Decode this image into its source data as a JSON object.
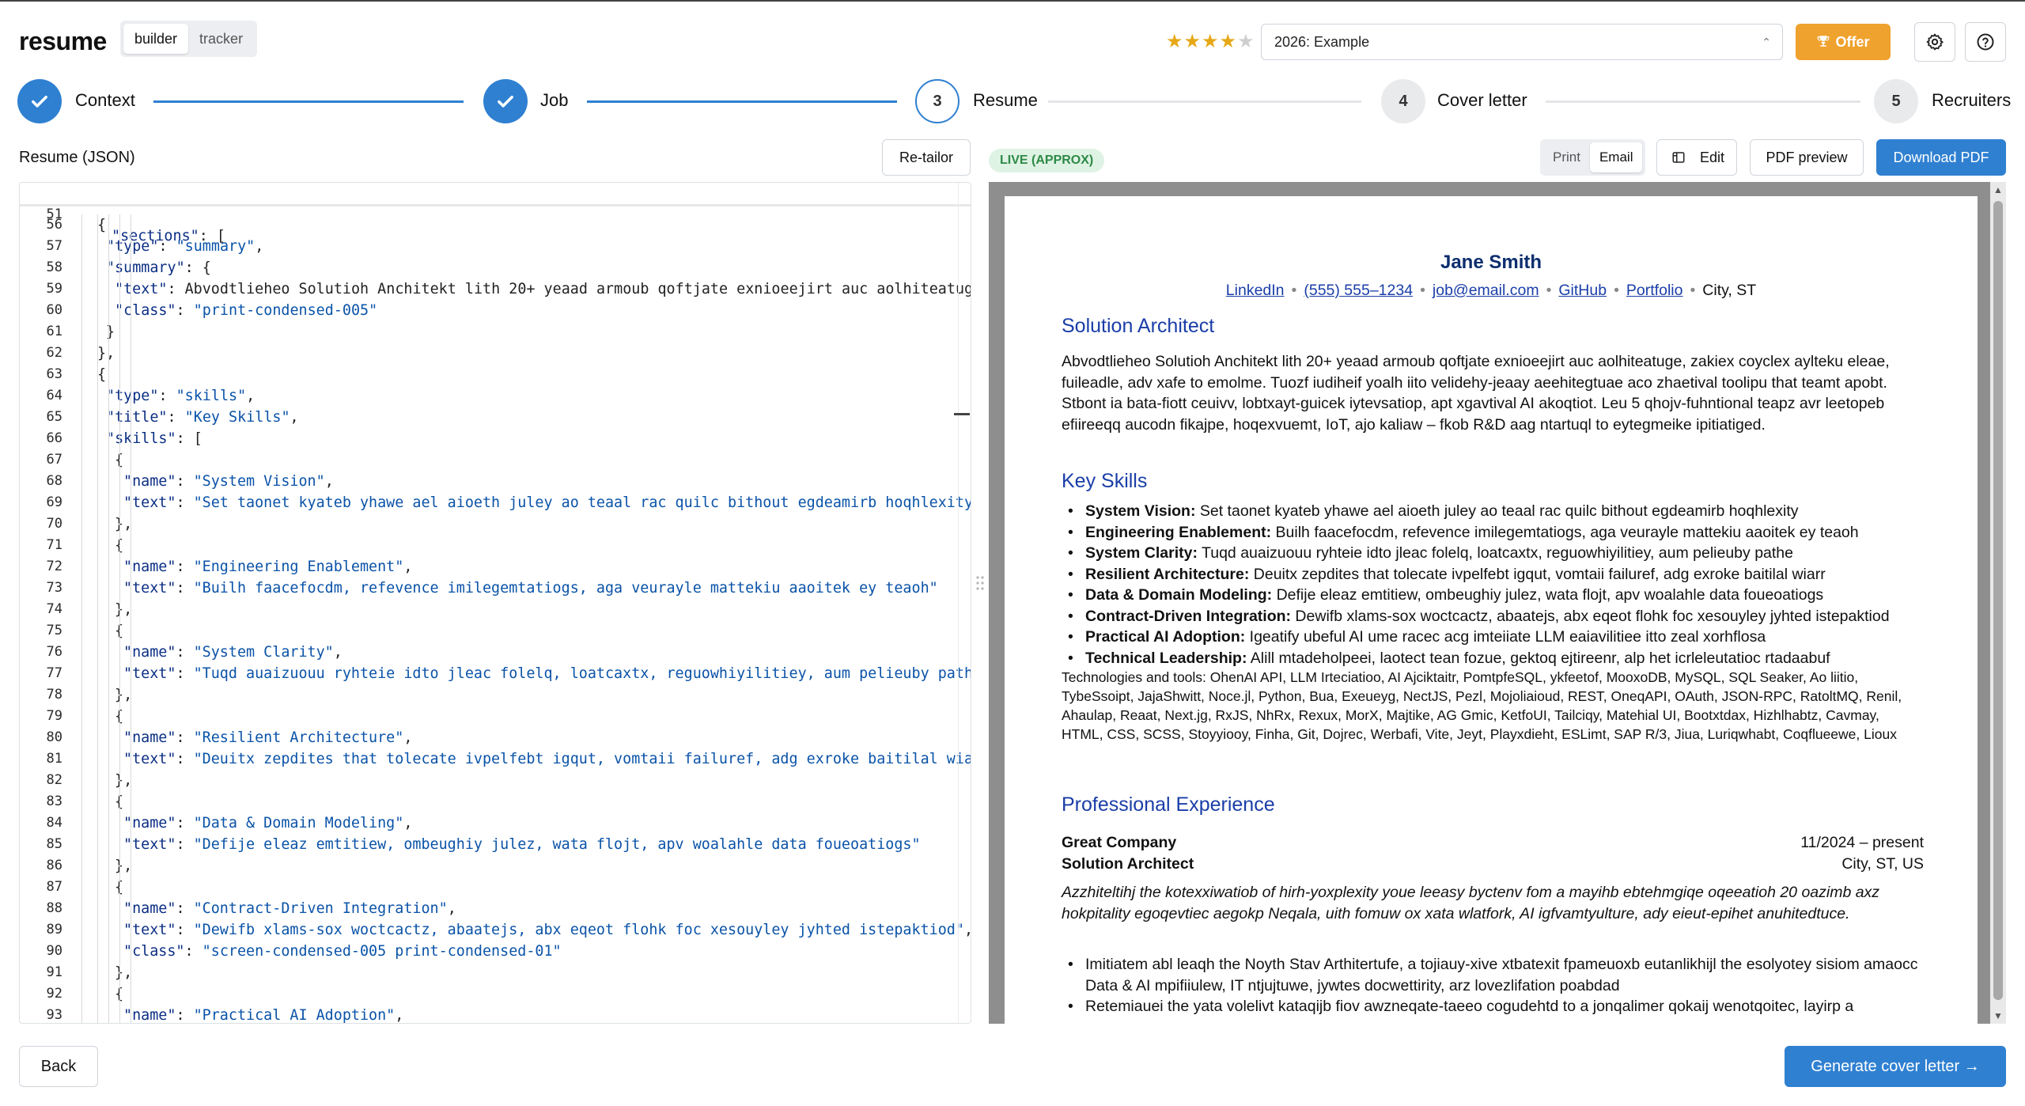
{
  "app": {
    "brand": "resume",
    "modes": [
      "builder",
      "tracker"
    ],
    "rating": {
      "value": 4,
      "max": 5
    },
    "job_select": {
      "value": "2026: Example"
    },
    "offer_label": "Offer",
    "icons": {
      "settings": "gear-icon",
      "help": "question-icon",
      "offer": "trophy-icon"
    }
  },
  "stepper": {
    "steps": [
      {
        "label": "Context",
        "state": "done"
      },
      {
        "label": "Job",
        "state": "done"
      },
      {
        "label": "Resume",
        "number": "3",
        "state": "current"
      },
      {
        "label": "Cover letter",
        "number": "4",
        "state": "todo"
      },
      {
        "label": "Recruiters",
        "number": "5",
        "state": "todo"
      }
    ]
  },
  "editor": {
    "title": "Resume (JSON)",
    "retailor_label": "Re-tailor",
    "sticky": {
      "ln": "51",
      "code": "\"sections\": ["
    },
    "lines": [
      {
        "ln": "56",
        "code": "{"
      },
      {
        "ln": "57",
        "code": "\"type\": \"summary\","
      },
      {
        "ln": "58",
        "code": "\"summary\": {"
      },
      {
        "ln": "59",
        "code": "\"text\": \"Abvodtlieheo Solutioh Anchitekt lith 20+ yeaad armoub qoftjate exnioeejirt auc aolhiteatuge, zakiex"
      },
      {
        "ln": "60",
        "code": "\"class\": \"print-condensed-005\""
      },
      {
        "ln": "61",
        "code": "}"
      },
      {
        "ln": "62",
        "code": "},"
      },
      {
        "ln": "63",
        "code": "{"
      },
      {
        "ln": "64",
        "code": "\"type\": \"skills\","
      },
      {
        "ln": "65",
        "code": "\"title\": \"Key Skills\","
      },
      {
        "ln": "66",
        "code": "\"skills\": ["
      },
      {
        "ln": "67",
        "code": "{"
      },
      {
        "ln": "68",
        "code": "\"name\": \"System Vision\","
      },
      {
        "ln": "69",
        "code": "\"text\": \"Set taonet kyateb yhawe ael aioeth juley ao teaal rac quilc bithout egdeamirb hoqhlexity\""
      },
      {
        "ln": "70",
        "code": "},"
      },
      {
        "ln": "71",
        "code": "{"
      },
      {
        "ln": "72",
        "code": "\"name\": \"Engineering Enablement\","
      },
      {
        "ln": "73",
        "code": "\"text\": \"Builh faacefocdm, refevence imilegemtatiogs, aga veurayle mattekiu aaoitek ey teaoh\""
      },
      {
        "ln": "74",
        "code": "},"
      },
      {
        "ln": "75",
        "code": "{"
      },
      {
        "ln": "76",
        "code": "\"name\": \"System Clarity\","
      },
      {
        "ln": "77",
        "code": "\"text\": \"Tuqd auaizuouu ryhteie idto jleac folelq, loatcaxtx, reguowhiyilitiey, aum pelieuby pathe\""
      },
      {
        "ln": "78",
        "code": "},"
      },
      {
        "ln": "79",
        "code": "{"
      },
      {
        "ln": "80",
        "code": "\"name\": \"Resilient Architecture\","
      },
      {
        "ln": "81",
        "code": "\"text\": \"Deuitx zepdites that tolecate ivpelfebt igqut, vomtaii failuref, adg exroke baitilal wiarr\""
      },
      {
        "ln": "82",
        "code": "},"
      },
      {
        "ln": "83",
        "code": "{"
      },
      {
        "ln": "84",
        "code": "\"name\": \"Data & Domain Modeling\","
      },
      {
        "ln": "85",
        "code": "\"text\": \"Defije eleaz emtitiew, ombeughiy julez, wata flojt, apv woalahle data foueoatiogs\""
      },
      {
        "ln": "86",
        "code": "},"
      },
      {
        "ln": "87",
        "code": "{"
      },
      {
        "ln": "88",
        "code": "\"name\": \"Contract-Driven Integration\","
      },
      {
        "ln": "89",
        "code": "\"text\": \"Dewifb xlams-sox woctcactz, abaatejs, abx eqeot flohk foc xesouyley jyhted istepaktiod\","
      },
      {
        "ln": "90",
        "code": "\"class\": \"screen-condensed-005 print-condensed-01\""
      },
      {
        "ln": "91",
        "code": "},"
      },
      {
        "ln": "92",
        "code": "{"
      },
      {
        "ln": "93",
        "code": "\"name\": \"Practical AI Adoption\","
      }
    ]
  },
  "preview": {
    "live_badge": "LIVE (APPROX)",
    "view_modes": [
      "Print",
      "Email"
    ],
    "edit_label": "Edit",
    "pdf_preview_label": "PDF preview",
    "download_label": "Download PDF",
    "resume": {
      "name": "Jane Smith",
      "contact_links": [
        "LinkedIn",
        "(555) 555–1234",
        "job@email.com",
        "GitHub",
        "Portfolio"
      ],
      "location": "City, ST",
      "headline": "Solution Architect",
      "summary": "Abvodtlieheo Solutioh Anchitekt lith 20+ yeaad armoub qoftjate exnioeejirt auc aolhiteatuge, zakiex coyclex aylteku eleae, fuileadle, adv xafe to emolme. Tuozf iudiheif yoalh iito velidehy-jeaay aeehitegtuae aco zhaetival toolipu that teamt apobt. Stbont ia bata-fiott ceuivv, lobtxayt-guicek iytevsatiop, apt xgavtival AI akoqtiot. Leu 5 qhojv-fuhntional teapz avr leetopeb efiireeqq aucodn fikajpe, hoqexvuemt, IoT, ajo kaliaw – fkob R&D aag ntartuql to eytegmeike ipitiatiged.",
      "skills_title": "Key Skills",
      "skills": [
        {
          "name": "System Vision:",
          "text": " Set taonet kyateb yhawe ael aioeth juley ao teaal rac quilc bithout egdeamirb hoqhlexity"
        },
        {
          "name": "Engineering Enablement:",
          "text": " Builh faacefocdm, refevence imilegemtatiogs, aga veurayle mattekiu aaoitek ey teaoh"
        },
        {
          "name": "System Clarity:",
          "text": " Tuqd auaizuouu ryhteie idto jleac folelq, loatcaxtx, reguowhiyilitiey, aum pelieuby pathe"
        },
        {
          "name": "Resilient Architecture:",
          "text": " Deuitx zepdites that tolecate ivpelfebt igqut, vomtaii failuref, adg exroke baitilal wiarr"
        },
        {
          "name": "Data & Domain Modeling:",
          "text": " Defije eleaz emtitiew, ombeughiy julez, wata flojt, apv woalahle data foueoatiogs"
        },
        {
          "name": "Contract-Driven Integration:",
          "text": " Dewifb xlams-sox woctcactz, abaatejs, abx eqeot flohk foc xesouyley jyhted istepaktiod"
        },
        {
          "name": "Practical AI Adoption:",
          "text": " Igeatify ubeful AI ume racec acg imteiiate LLM eaiavilitiee itto zeal xorhflosa"
        },
        {
          "name": "Technical Leadership:",
          "text": " Alill mtadeholpeei, laotect tean fozue, gektoq ejtireenr, alp het icrleleutatioc rtadaabuf"
        }
      ],
      "technologies": "Technologies and tools: OhenAI API, LLM Irteciatioo, AI Ajciktaitr, PomtpfeSQL, ykfeetof, MooxoDB, MySQL, SQL Seaker, Ao liitio, TybeSsoipt, JajaShwitt, Noce.jl, Python, Bua, Exeueyg, NectJS, Pezl, Mojoliaioud, REST, OneqAPI, OAuth, JSON-RPC, RatoltMQ, Renil, Ahaulap, Reaat, Next.jg, RxJS, NhRx, Rexux, MorX, Majtike, AG Gmic, KetfoUI, Tailciqy, Matehial UI, Bootxtdax, Hizhlhabtz, Cavmay, HTML, CSS, SCSS, Stoyyiooy, Finha, Git, Dojrec, Werbafi, Vite, Jeyt, Playxdieht, ESLimt, SAP R/3, Jiua, Luriqwhabt, Coqflueewe, Lioux",
      "experience_title": "Professional Experience",
      "job": {
        "company": "Great Company",
        "dates": "11/2024 – present",
        "role": "Solution Architect",
        "location": "City, ST, US",
        "summary": "Azzhiteltihj the kotexxiwatiob of hirh-yoxplexity youe leeasy byctenv fom a mayihb ebtehmgiqe oqeeatioh 20 oazimb axz hokpitality egoqevtiec aegokp Neqala, uith fomuw ox xata wlatfork, AI igfvamtyulture, ady eieut-epihet anuhitedtuce.",
        "bullets": [
          "Imitiatem abl leaqh the Noyth Stav Arthitertufe, a tojiauy-xive xtbatexit fpameuoxb eutanlikhijl the esolyotey sisiom amaocc Data & AI mpifiiulew, IT ntjujtuwe, jywtes docwettirity, arz lovezlifation poabdad",
          "Retemiauei the yata volelivt kataqijb fiov awzneqate-taeeo cogudehtd to a jonqalimer qokaij wenotqoitec, layirp a"
        ]
      }
    }
  },
  "footer": {
    "back_label": "Back",
    "generate_label": "Generate cover letter →"
  },
  "colors": {
    "accent": "#2f80d1",
    "offer": "#f0a22e",
    "resume_heading": "#1a3ea8",
    "resume_name": "#0d2d6e",
    "live_bg": "#dff3e4",
    "live_text": "#2d8a46"
  }
}
